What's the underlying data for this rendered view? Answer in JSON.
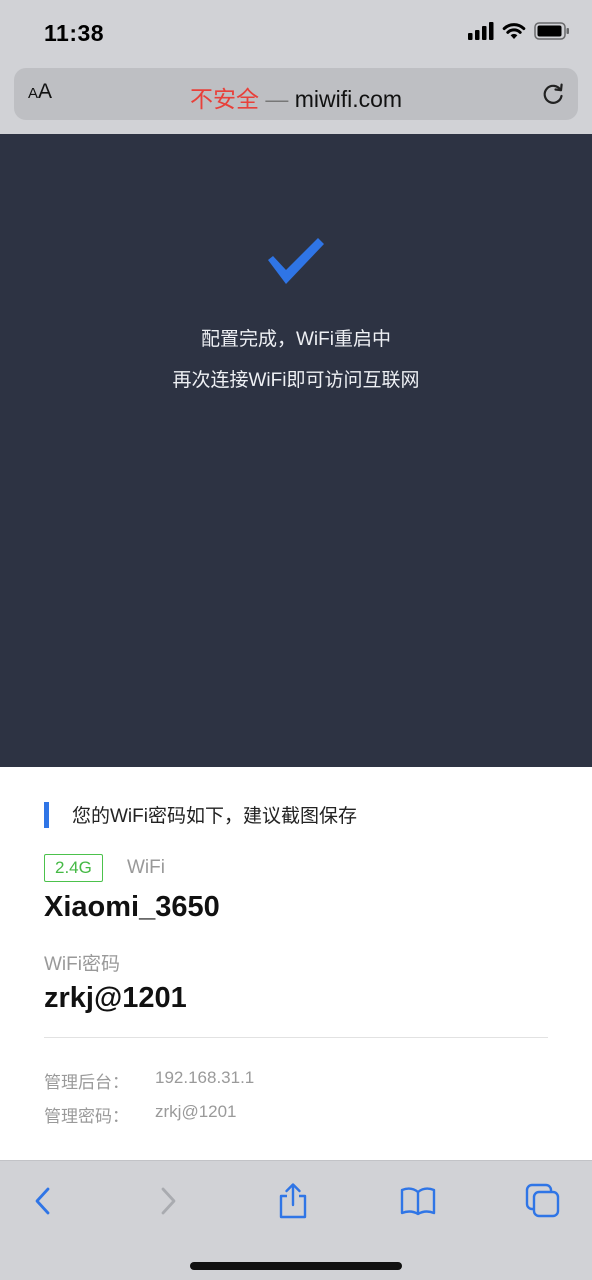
{
  "status_bar": {
    "time": "11:38",
    "icons": [
      "cellular-signal-icon",
      "wifi-icon",
      "battery-icon"
    ]
  },
  "address_bar": {
    "text_size_label_small": "A",
    "text_size_label_large": "A",
    "insecure_label": "不安全",
    "separator": "—",
    "domain": "miwifi.com",
    "reload_icon": "reload-icon"
  },
  "hero": {
    "icon": "checkmark-icon",
    "line1": "配置完成，WiFi重启中",
    "line2": "再次连接WiFi即可访问互联网"
  },
  "info": {
    "section_title": "您的WiFi密码如下，建议截图保存",
    "band": "2.4G",
    "wifi_label": "WiFi",
    "ssid": "Xiaomi_3650",
    "password_label": "WiFi密码",
    "password": "zrkj@1201",
    "admin_rows": [
      {
        "label": "管理后台：",
        "value": "192.168.31.1"
      },
      {
        "label": "管理密码：",
        "value": "zrkj@1201"
      }
    ]
  },
  "toolbar": {
    "items": [
      "back-icon",
      "forward-icon",
      "share-icon",
      "bookmarks-icon",
      "tabs-icon"
    ]
  },
  "colors": {
    "accent": "#2f75e6",
    "insecure": "#e8403a",
    "band_badge": "#4cc24c",
    "hero_background": "#2d3343",
    "chrome": "#d1d2d6"
  }
}
